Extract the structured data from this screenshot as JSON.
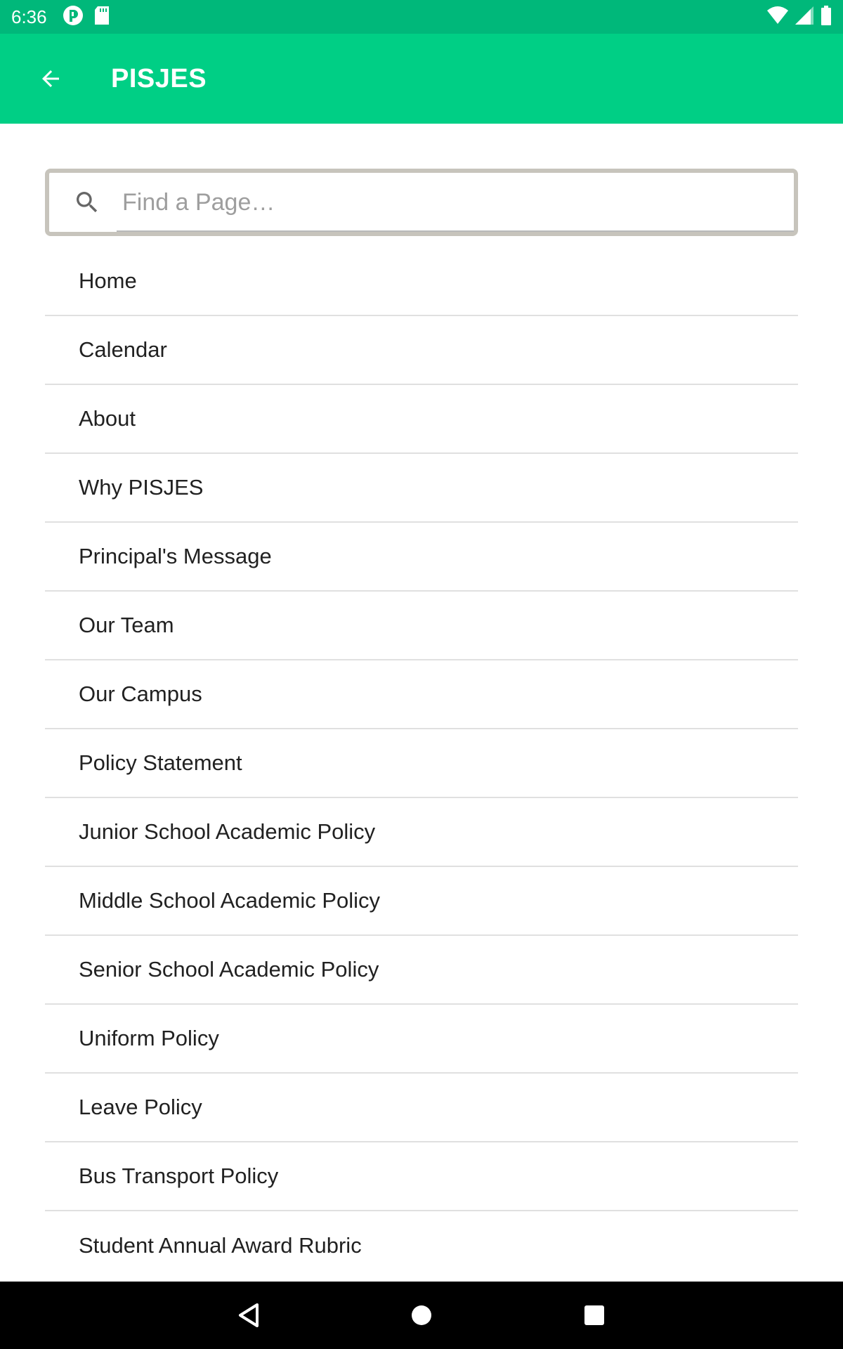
{
  "status_bar": {
    "time": "6:36",
    "left_icons": [
      "notification-app-icon",
      "sd-card-icon"
    ],
    "right_icons": [
      "wifi-icon",
      "signal-icon",
      "battery-icon"
    ]
  },
  "app_bar": {
    "title": "PISJES",
    "back_icon": "arrow-back-icon",
    "background": "#00CF85",
    "status_background": "#00B87A"
  },
  "search": {
    "placeholder": "Find a Page…",
    "value": "",
    "icon": "search-icon"
  },
  "pages": [
    {
      "label": "Home"
    },
    {
      "label": "Calendar"
    },
    {
      "label": "About"
    },
    {
      "label": "Why PISJES"
    },
    {
      "label": "Principal's Message"
    },
    {
      "label": "Our Team"
    },
    {
      "label": "Our Campus"
    },
    {
      "label": "Policy Statement"
    },
    {
      "label": "Junior School Academic Policy"
    },
    {
      "label": "Middle School Academic Policy"
    },
    {
      "label": "Senior School Academic Policy"
    },
    {
      "label": "Uniform Policy"
    },
    {
      "label": "Leave Policy"
    },
    {
      "label": "Bus Transport Policy"
    },
    {
      "label": "Student Annual Award Rubric"
    }
  ],
  "nav_bar": {
    "buttons": [
      "back-triangle-icon",
      "home-circle-icon",
      "recents-square-icon"
    ]
  }
}
